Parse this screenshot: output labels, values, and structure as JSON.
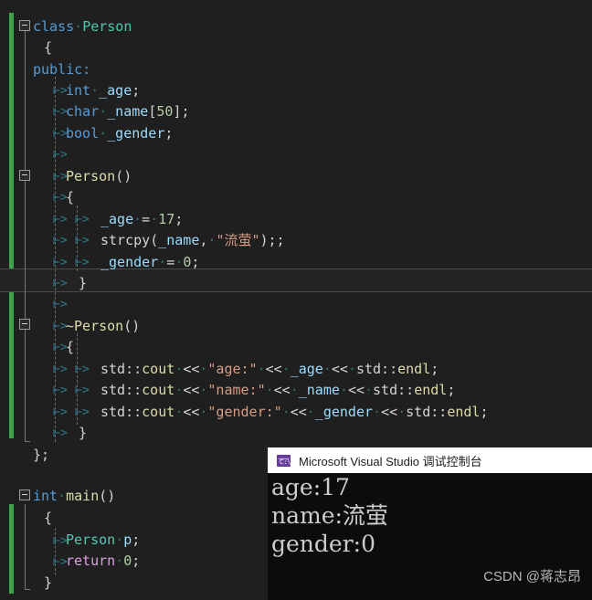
{
  "editor": {
    "theme_bg": "#1f1f1f",
    "change_bar_color": "#3fa34d",
    "current_line_index": 12,
    "lines": [
      {
        "n": 0,
        "text": "class Person"
      },
      {
        "n": 1,
        "text": "{"
      },
      {
        "n": 2,
        "text": "public:"
      },
      {
        "n": 3,
        "text": "    int _age;"
      },
      {
        "n": 4,
        "text": "    char _name[50];"
      },
      {
        "n": 5,
        "text": "    bool _gender;"
      },
      {
        "n": 6,
        "text": ""
      },
      {
        "n": 7,
        "text": "    Person()"
      },
      {
        "n": 8,
        "text": "    {"
      },
      {
        "n": 9,
        "text": "        _age = 17;"
      },
      {
        "n": 10,
        "text": "        strcpy(_name, \"流萤\");;"
      },
      {
        "n": 11,
        "text": "        _gender = 0;"
      },
      {
        "n": 12,
        "text": "    }"
      },
      {
        "n": 13,
        "text": ""
      },
      {
        "n": 14,
        "text": "    ~Person()"
      },
      {
        "n": 15,
        "text": "    {"
      },
      {
        "n": 16,
        "text": "        std::cout << \"age:\" << _age << std::endl;"
      },
      {
        "n": 17,
        "text": "        std::cout << \"name:\" << _name << std::endl;"
      },
      {
        "n": 18,
        "text": "        std::cout << \"gender:\" << _gender << std::endl;"
      },
      {
        "n": 19,
        "text": "    }"
      },
      {
        "n": 20,
        "text": "};"
      },
      {
        "n": 21,
        "text": ""
      },
      {
        "n": 22,
        "text": "int main()"
      },
      {
        "n": 23,
        "text": "{"
      },
      {
        "n": 24,
        "text": "    Person p;"
      },
      {
        "n": 25,
        "text": "    return 0;"
      },
      {
        "n": 26,
        "text": "}"
      }
    ],
    "tokens": {
      "class_kw": "class",
      "class_name": "Person",
      "open_brace": "{",
      "close_brace": "}",
      "public_kw": "public:",
      "int_kw": "int",
      "age_member": "_age",
      "semi": ";",
      "char_kw": "char",
      "name_member": "_name",
      "array_open": "[",
      "array_size": "50",
      "array_close": "]",
      "bool_kw": "bool",
      "gender_member": "_gender",
      "ctor_name": "Person",
      "parens": "()",
      "assign": "=",
      "age_value": "17",
      "strcpy_fn": "strcpy",
      "paren_open": "(",
      "comma": ",",
      "name_literal": "\"流萤\"",
      "paren_close": ")",
      "double_semi": ";;",
      "gender_value": "0",
      "dtor_name": "~Person",
      "std_ns": "std::",
      "cout_fn": "cout",
      "endl_fn": "endl",
      "shift": "<<",
      "age_label": "\"age:\"",
      "name_label": "\"name:\"",
      "gender_label": "\"gender:\"",
      "class_end": "};",
      "main_int": "int",
      "main_name": "main",
      "person_type": "Person",
      "person_obj": "p",
      "return_kw": "return",
      "return_value": "0"
    }
  },
  "console": {
    "title": "Microsoft Visual Studio 调试控制台",
    "icon": "console-icon",
    "icon_glyph": "C:\\",
    "output": [
      "age:17",
      "name:流萤",
      "gender:0"
    ],
    "watermark": "CSDN @蒋志昂"
  }
}
